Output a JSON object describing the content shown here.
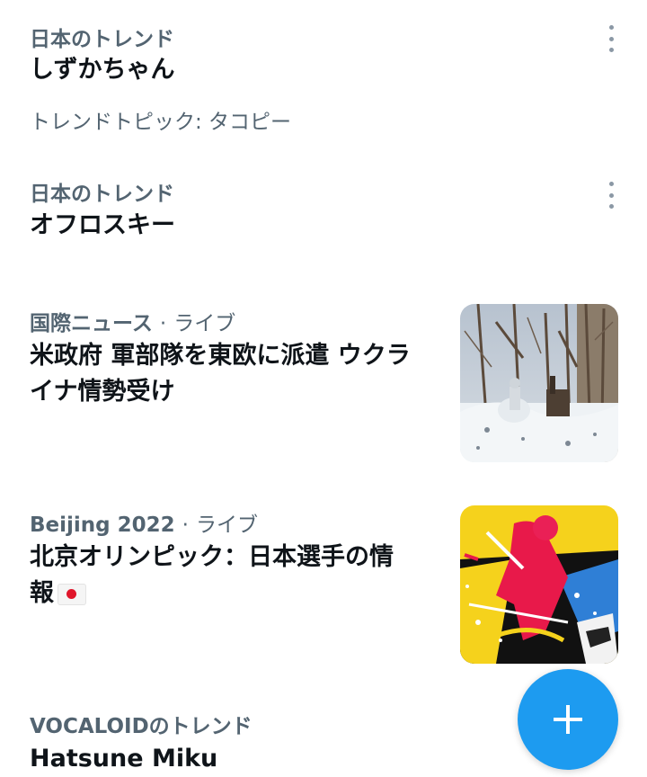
{
  "trends": [
    {
      "context": "日本のトレンド",
      "title": "しずかちゃん",
      "subtitle": "トレンドトピック: タコピー"
    },
    {
      "context": "日本のトレンド",
      "title": "オフロスキー"
    },
    {
      "context": "国際ニュース",
      "separator": "·",
      "live": "ライブ",
      "title_line1": "米政府 軍部隊を東欧に派遣 ウクラ",
      "title_line2": "イナ情勢受け",
      "image": "snowy-forest-soldier-photo"
    },
    {
      "context": "Beijing 2022",
      "separator": "·",
      "live": "ライブ",
      "title_line1": "北京オリンピック：日本選手の情",
      "title_line2": "報",
      "flag": "japan-flag-emoji",
      "image": "olympic-athlete-illustration"
    },
    {
      "context": "VOCALOIDのトレンド",
      "title": "Hatsune Miku"
    }
  ],
  "fab": {
    "icon": "plus-icon",
    "color": "#1d9bf0"
  }
}
